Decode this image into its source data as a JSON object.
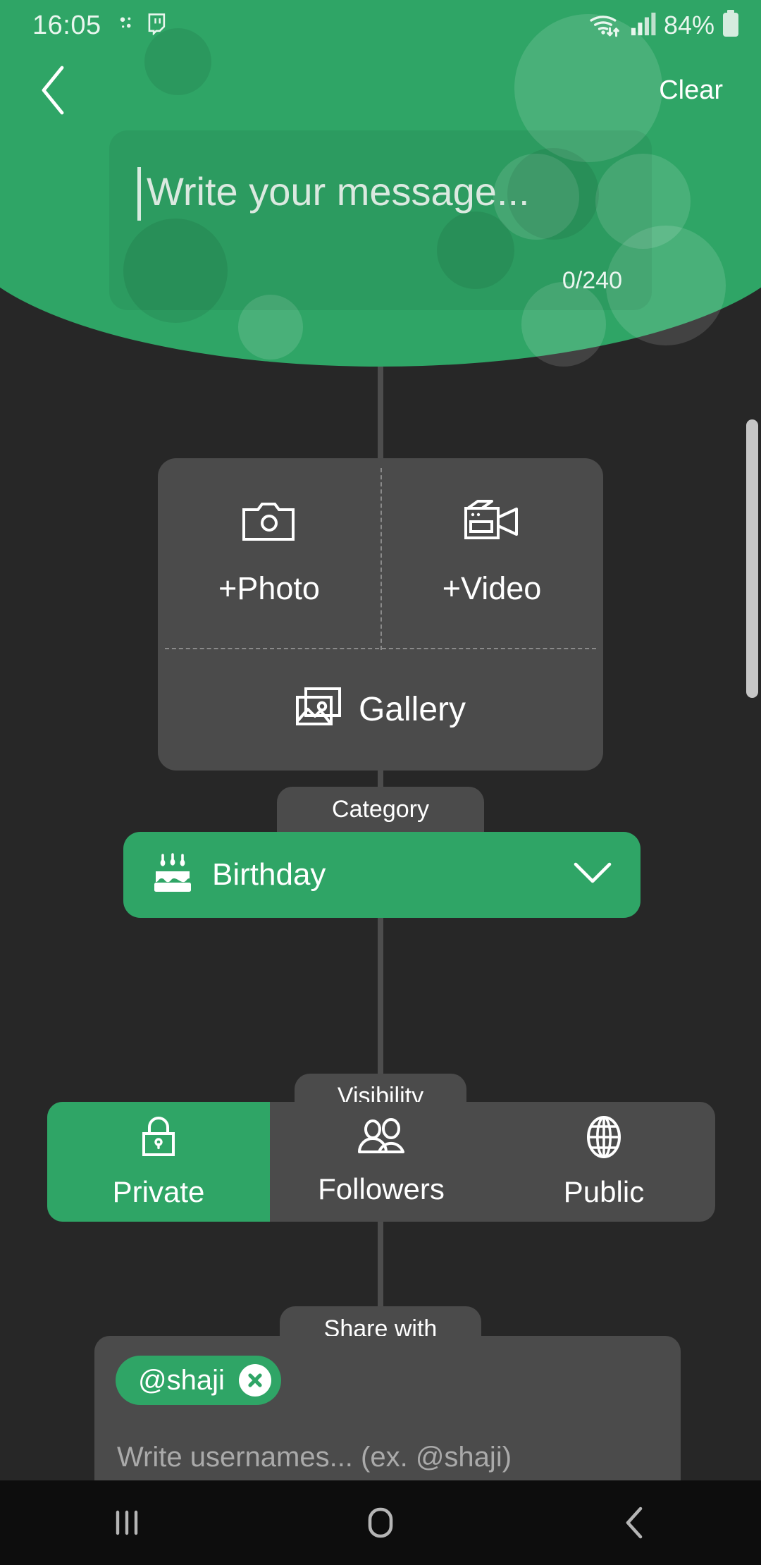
{
  "status_bar": {
    "clock": "16:05",
    "battery_percent": "84%",
    "icons": [
      "snapchat-icon",
      "twitch-icon",
      "wifi-icon",
      "signal-icon",
      "battery-icon"
    ]
  },
  "header": {
    "back_label": "back-chevron",
    "clear_label": "Clear",
    "composer": {
      "placeholder": "Write your message...",
      "value": "",
      "counter": "0/240",
      "max_chars": 240
    },
    "accent_color": "#2fa566"
  },
  "media": {
    "photo_label": "+Photo",
    "video_label": "+Video",
    "gallery_label": "Gallery"
  },
  "category": {
    "tab_label": "Category",
    "selected": "Birthday",
    "icon": "birthday-cake-icon"
  },
  "visibility": {
    "tab_label": "Visibility",
    "options": [
      {
        "label": "Private",
        "icon": "lock-icon",
        "selected": true
      },
      {
        "label": "Followers",
        "icon": "people-icon",
        "selected": false
      },
      {
        "label": "Public",
        "icon": "globe-icon",
        "selected": false
      }
    ]
  },
  "share_with": {
    "tab_label": "Share with",
    "chips": [
      {
        "name": "@shaji"
      }
    ],
    "placeholder": "Write usernames... (ex. @shaji)",
    "value": ""
  },
  "nav_bar": {
    "recents_label": "recents-icon",
    "home_label": "home-icon",
    "back_label": "back-icon"
  },
  "colors": {
    "accent_green": "#2fa566",
    "card_gray": "#4b4b4b",
    "page_bg": "#272727",
    "nav_bg": "#0d0d0d"
  }
}
